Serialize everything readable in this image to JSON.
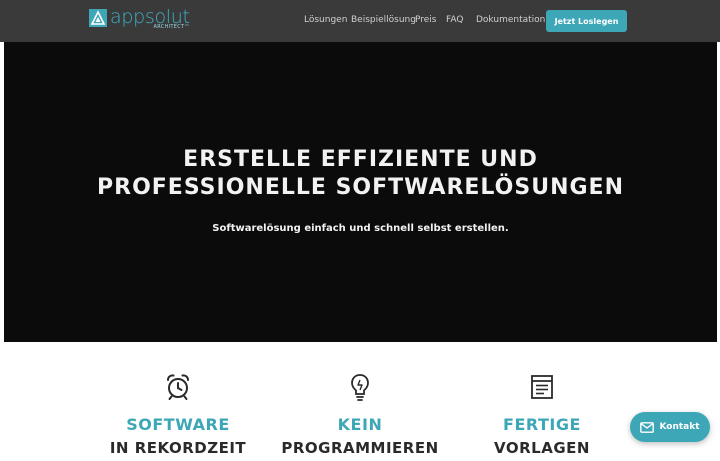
{
  "brand": {
    "name": "appsolut",
    "sub": "ARCHITECT™",
    "accent": "#3ea7b7",
    "nav_bg": "#3a3a3b",
    "hero_bg": "#0b0b0c"
  },
  "nav": {
    "links": [
      "Lösungen",
      "Beispiellösung",
      "Preis",
      "FAQ",
      "Dokumentation"
    ],
    "cta_label": "Jetzt Loslegen"
  },
  "hero": {
    "title_line1": "ERSTELLE EFFIZIENTE UND",
    "title_line2": "PROFESSIONELLE SOFTWARELÖSUNGEN",
    "subtitle": "Softwarelösung einfach und schnell selbst erstellen."
  },
  "features": [
    {
      "icon": "alarm-clock-icon",
      "title": "SOFTWARE",
      "subtitle": "IN REKORDZEIT"
    },
    {
      "icon": "lightbulb-icon",
      "title": "KEIN",
      "subtitle": "PROGRAMMIEREN"
    },
    {
      "icon": "template-icon",
      "title": "FERTIGE",
      "subtitle": "VORLAGEN"
    }
  ],
  "kontakt": {
    "label": "Kontakt",
    "icon": "envelope-icon"
  }
}
